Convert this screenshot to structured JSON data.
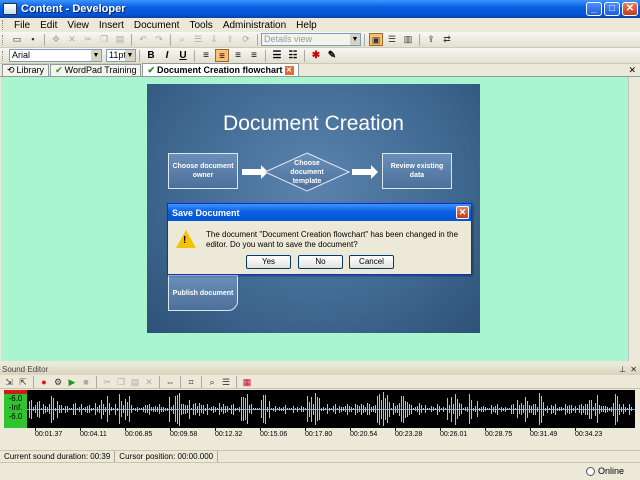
{
  "window": {
    "title": "Content - Developer"
  },
  "menu": [
    "File",
    "Edit",
    "View",
    "Insert",
    "Document",
    "Tools",
    "Administration",
    "Help"
  ],
  "toolbar": {
    "view_dropdown": "Details view"
  },
  "format": {
    "font": "Arial",
    "size": "11pt",
    "bold": "B",
    "italic": "I",
    "underline": "U"
  },
  "tabs": [
    {
      "label": "Library"
    },
    {
      "label": "WordPad Training"
    },
    {
      "label": "Document Creation flowchart"
    }
  ],
  "slide": {
    "title": "Document Creation",
    "nodes": {
      "owner": "Choose document owner",
      "template": "Choose document template",
      "review": "Review existing data",
      "publish": "Publish document"
    }
  },
  "dialog": {
    "title": "Save Document",
    "message": "The document \"Document Creation flowchart\" has been changed in the editor. Do you want to save the document?",
    "yes": "Yes",
    "no": "No",
    "cancel": "Cancel"
  },
  "sound": {
    "panel_title": "Sound Editor",
    "level_top": "-6.0",
    "level_mid": "-Inf.",
    "level_bottom": "-6.0",
    "timeline": [
      "00:01.37",
      "00:04.11",
      "00:06.85",
      "00:09.58",
      "00:12.32",
      "00:15.06",
      "00:17.80",
      "00:20.54",
      "00:23.28",
      "00:26.01",
      "00:28.75",
      "00:31.49",
      "00:34.23"
    ],
    "duration": "Current sound duration: 00:39",
    "cursor": "Cursor position: 00:00.000"
  },
  "status": {
    "online": "Online"
  }
}
